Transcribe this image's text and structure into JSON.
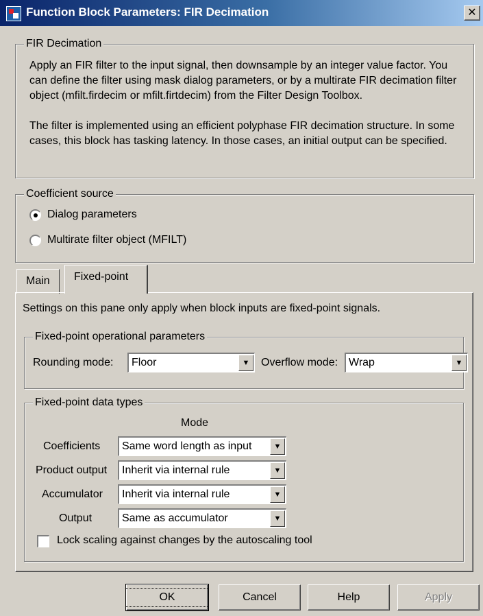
{
  "window": {
    "title": "Function Block Parameters: FIR Decimation",
    "close_glyph": "✕"
  },
  "description": {
    "legend": "FIR Decimation",
    "para1": "Apply an FIR filter to the input signal, then downsample by an integer value factor. You can define the filter using mask dialog parameters, or by a multirate FIR decimation filter object (mfilt.firdecim or mfilt.firtdecim) from the Filter Design Toolbox.",
    "para2": "The filter is implemented using an efficient polyphase FIR decimation structure. In some cases, this block has tasking latency. In those cases, an initial output can be specified."
  },
  "coefficient_source": {
    "legend": "Coefficient source",
    "options": [
      {
        "label": "Dialog parameters",
        "checked": true
      },
      {
        "label": "Multirate filter object (MFILT)",
        "checked": false
      }
    ]
  },
  "tabs": [
    {
      "label": "Main",
      "active": false
    },
    {
      "label": "Fixed-point",
      "active": true
    }
  ],
  "fixed_point": {
    "note": "Settings on this pane only apply when block inputs are fixed-point signals.",
    "operational": {
      "legend": "Fixed-point operational parameters",
      "rounding_label": "Rounding mode:",
      "rounding_value": "Floor",
      "overflow_label": "Overflow mode:",
      "overflow_value": "Wrap"
    },
    "data_types": {
      "legend": "Fixed-point data types",
      "mode_header": "Mode",
      "rows": [
        {
          "label": "Coefficients",
          "value": "Same word length as input"
        },
        {
          "label": "Product output",
          "value": "Inherit via internal rule"
        },
        {
          "label": "Accumulator",
          "value": "Inherit via internal rule"
        },
        {
          "label": "Output",
          "value": "Same as accumulator"
        }
      ],
      "lock_label": "Lock scaling against changes by the autoscaling tool",
      "lock_checked": false
    }
  },
  "buttons": {
    "ok": "OK",
    "cancel": "Cancel",
    "help": "Help",
    "apply": "Apply"
  },
  "icons": {
    "dropdown": "▼"
  }
}
